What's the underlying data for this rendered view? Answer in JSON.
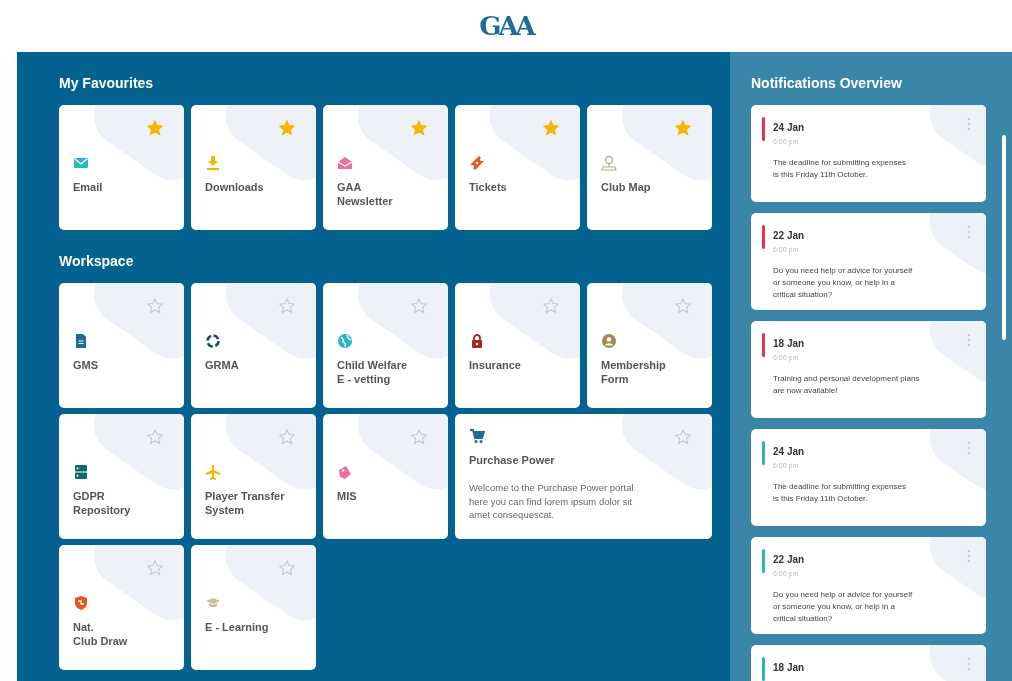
{
  "logo": "GAA",
  "favourites": {
    "title": "My Favourites",
    "tiles": [
      {
        "label": "Email",
        "favourite": true
      },
      {
        "label": "Downloads",
        "favourite": true
      },
      {
        "label": "GAA\nNewsletter",
        "favourite": true
      },
      {
        "label": "Tickets",
        "favourite": true
      },
      {
        "label": "Club Map",
        "favourite": true
      }
    ]
  },
  "workspace": {
    "title": "Workspace",
    "tiles": [
      {
        "kind": "app",
        "label": "GMS",
        "favourite": false
      },
      {
        "kind": "app",
        "label": "GRMA",
        "favourite": false
      },
      {
        "kind": "app",
        "label": "Child Welfare\nE - vetting",
        "favourite": false
      },
      {
        "kind": "app",
        "label": "Insurance",
        "favourite": false
      },
      {
        "kind": "app",
        "label": "Membership\nForm",
        "favourite": false
      },
      {
        "kind": "app",
        "label": "GDPR\nRepository",
        "favourite": false
      },
      {
        "kind": "app",
        "label": "Player Transfer\nSystem",
        "favourite": false
      },
      {
        "kind": "app",
        "label": "MIS",
        "favourite": false
      },
      {
        "kind": "feature",
        "label": "Purchase Power",
        "description": "Welcome to the Purchase Power portal\nhere you can find lorem ipsum dolor sit\namet consequescat.",
        "favourite": false
      },
      {
        "kind": "app",
        "label": "Nat.\nClub Draw",
        "favourite": false
      },
      {
        "kind": "app",
        "label": "E - Learning",
        "favourite": false
      }
    ]
  },
  "notifications": {
    "title": "Notifications Overview",
    "items": [
      {
        "date": "24 Jan",
        "time": "6:00 pm",
        "text": "The deadline for submitting expenses\nis this Friday 11th October.",
        "color": "#e8344a"
      },
      {
        "date": "22 Jan",
        "time": "6:00 pm",
        "text": "Do you need help or advice for yourself\nor someone you know, or help in a\ncritical situation?",
        "color": "#e8344a"
      },
      {
        "date": "18 Jan",
        "time": "6:00 pm",
        "text": "Training and personal development plans\nare now available!",
        "color": "#e8344a"
      },
      {
        "date": "24 Jan",
        "time": "6:00 pm",
        "text": "The deadline for submitting expenses\nis this Friday 11th October.",
        "color": "#2bb6c6"
      },
      {
        "date": "22 Jan",
        "time": "6:00 pm",
        "text": "Do you need help or advice for yourself\nor someone you know, or help in a\ncritical situation?",
        "color": "#2bb6c6"
      },
      {
        "date": "18 Jan",
        "color": "#2bb6c6"
      }
    ]
  }
}
